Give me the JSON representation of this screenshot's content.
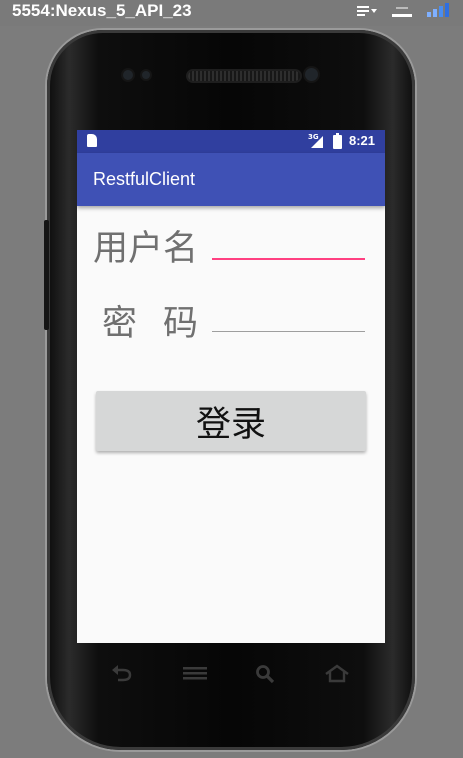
{
  "window": {
    "title": "5554:Nexus_5_API_23",
    "icons": [
      "menu-dropdown-icon",
      "minimize-icon",
      "signal-strength-icon"
    ]
  },
  "status_bar": {
    "network": "3G",
    "time": "8:21",
    "icons": [
      "sd-card-icon",
      "cell-signal-icon",
      "battery-charging-icon"
    ]
  },
  "app": {
    "title": "RestfulClient"
  },
  "form": {
    "username_label": "用户名",
    "username_value": "",
    "password_label": "密码",
    "password_value": "",
    "login_label": "登录"
  },
  "nav_bar": {
    "keys": [
      "back-icon",
      "menu-icon",
      "search-icon",
      "home-icon"
    ]
  },
  "colors": {
    "primary": "#3f51b5",
    "primary_dark": "#303f9f",
    "accent": "#ff4081",
    "background": "#fafafa",
    "button": "#d6d7d7"
  }
}
